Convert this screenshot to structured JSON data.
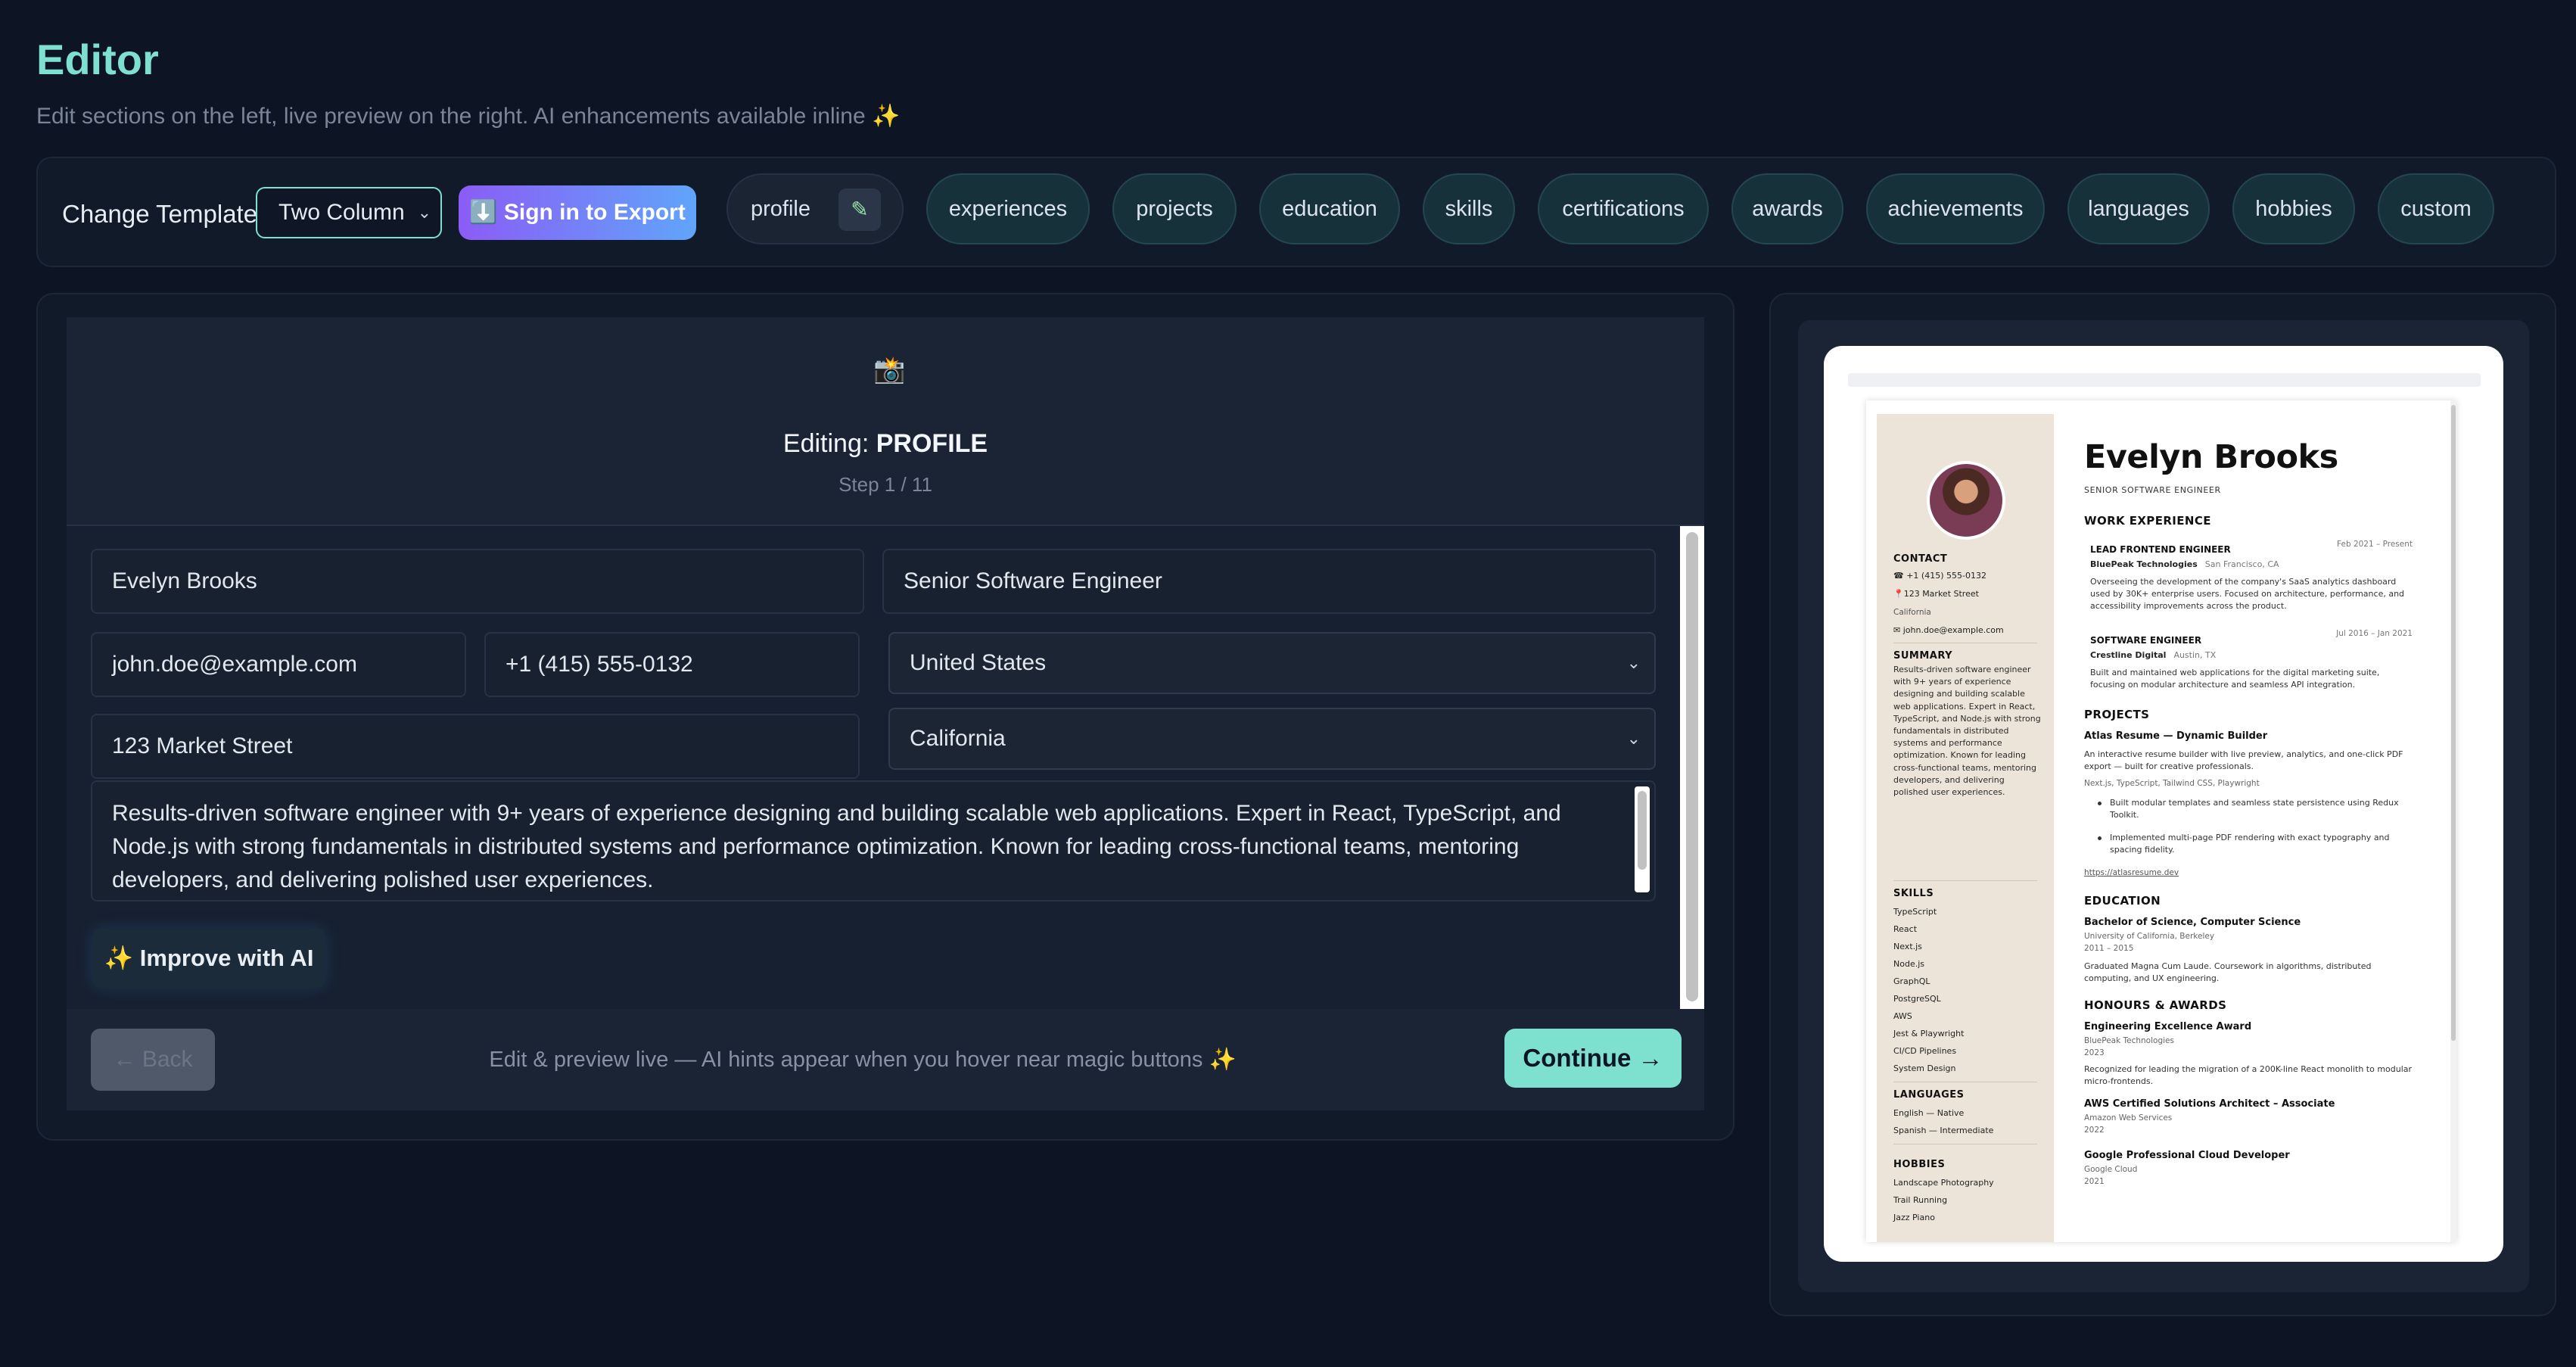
{
  "header": {
    "title": "Editor",
    "subtitle": "Edit sections on the left, live preview on the right. AI enhancements available inline ✨"
  },
  "toolbar": {
    "change_template_label": "Change Template",
    "template_select_value": "Two Column",
    "export_label": "⬇️ Sign in to Export",
    "section_pills": [
      "profile",
      "experiences",
      "projects",
      "education",
      "skills",
      "certifications",
      "awards",
      "achievements",
      "languages",
      "hobbies",
      "custom"
    ],
    "active_pill": "profile"
  },
  "editor": {
    "icon": "📸",
    "editing_prefix": "Editing:",
    "editing_section": "PROFILE",
    "step": "Step 1 / 11",
    "fields": {
      "full_name": "Evelyn Brooks",
      "job_title": "Senior Software Engineer",
      "email": "john.doe@example.com",
      "phone": "+1 (415) 555-0132",
      "country": "United States",
      "address": "123 Market Street",
      "state": "California",
      "summary": "Results-driven software engineer with 9+ years of experience designing and building scalable web applications. Expert in React, TypeScript, and Node.js with strong fundamentals in distributed systems and performance optimization. Known for leading cross-functional teams, mentoring developers, and delivering polished user experiences."
    },
    "improve_ai_label": "✨ Improve with AI",
    "back_label": "← Back",
    "footer_hint": "Edit & preview live — AI hints appear when you hover near magic buttons ✨",
    "continue_label": "Continue →"
  },
  "preview": {
    "name": "Evelyn Brooks",
    "role": "SENIOR SOFTWARE ENGINEER",
    "sidebar": {
      "contact_heading": "CONTACT",
      "phone": "☎ +1 (415) 555-0132",
      "address": "📍123 Market Street",
      "state": "California",
      "email": "✉ john.doe@example.com",
      "summary_heading": "SUMMARY",
      "summary": "Results-driven software engineer with 9+ years of experience designing and building scalable web applications. Expert in React, TypeScript, and Node.js with strong fundamentals in distributed systems and performance optimization. Known for leading cross-functional teams, mentoring developers, and delivering polished user experiences.",
      "skills_heading": "SKILLS",
      "skills": [
        "TypeScript",
        "React",
        "Next.js",
        "Node.js",
        "GraphQL",
        "PostgreSQL",
        "AWS",
        "Jest & Playwright",
        "CI/CD Pipelines",
        "System Design"
      ],
      "languages_heading": "LANGUAGES",
      "languages": [
        "English — Native",
        "Spanish — Intermediate"
      ],
      "hobbies_heading": "HOBBIES",
      "hobbies": [
        "Landscape Photography",
        "Trail Running",
        "Jazz Piano"
      ]
    },
    "work_heading": "WORK EXPERIENCE",
    "jobs": [
      {
        "title": "LEAD FRONTEND ENGINEER",
        "company": "BluePeak Technologies",
        "location": "San Francisco, CA",
        "dates": "Feb 2021 – Present",
        "description": "Overseeing the development of the company's SaaS analytics dashboard used by 30K+ enterprise users. Focused on architecture, performance, and accessibility improvements across the product."
      },
      {
        "title": "SOFTWARE ENGINEER",
        "company": "Crestline Digital",
        "location": "Austin, TX",
        "dates": "Jul 2016 – Jan 2021",
        "description": "Built and maintained web applications for the digital marketing suite, focusing on modular architecture and seamless API integration."
      }
    ],
    "projects_heading": "PROJECTS",
    "project": {
      "name": "Atlas Resume — Dynamic Builder",
      "description": "An interactive resume builder with live preview, analytics, and one-click PDF export — built for creative professionals.",
      "stack": "Next.js, TypeScript, Tailwind CSS, Playwright",
      "bullets": [
        "Built modular templates and seamless state persistence using Redux Toolkit.",
        "Implemented multi-page PDF rendering with exact typography and spacing fidelity."
      ],
      "link": "https://atlasresume.dev"
    },
    "education_heading": "EDUCATION",
    "education": {
      "degree": "Bachelor of Science, Computer Science",
      "school": "University of California, Berkeley",
      "years": "2011 – 2015",
      "description": "Graduated Magna Cum Laude. Coursework in algorithms, distributed computing, and UX engineering."
    },
    "awards_heading": "HONOURS & AWARDS",
    "awards": [
      {
        "name": "Engineering Excellence Award",
        "org": "BluePeak Technologies",
        "year": "2023",
        "description": "Recognized for leading the migration of a 200K-line React monolith to modular micro-frontends."
      },
      {
        "name": "AWS Certified Solutions Architect – Associate",
        "org": "Amazon Web Services",
        "year": "2022"
      },
      {
        "name": "Google Professional Cloud Developer",
        "org": "Google Cloud",
        "year": "2021"
      }
    ]
  },
  "colors": {
    "accent": "#7ee0cf",
    "background": "#0d1423",
    "panel": "#111a29",
    "export_gradient_start": "#8b5cf6",
    "export_gradient_end": "#60a5fa",
    "resume_sidebar": "#ece4d8"
  }
}
